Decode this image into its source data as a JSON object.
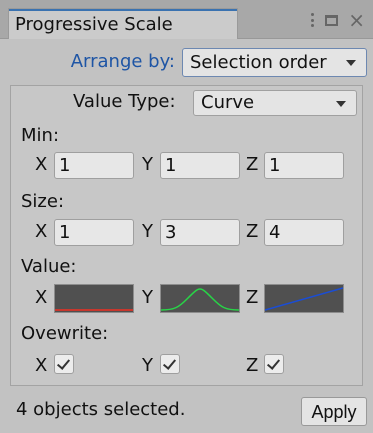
{
  "window": {
    "title": "Progressive Scale"
  },
  "arrange": {
    "label": "Arrange by:",
    "value": "Selection order"
  },
  "value_type": {
    "label": "Value Type:",
    "value": "Curve"
  },
  "axes": {
    "x": "X",
    "y": "Y",
    "z": "Z"
  },
  "min": {
    "label": "Min:",
    "x": "1",
    "y": "1",
    "z": "1"
  },
  "size": {
    "label": "Size:",
    "x": "1",
    "y": "3",
    "z": "4"
  },
  "value": {
    "label": "Value:",
    "curves": {
      "x": {
        "color": "#c8372d",
        "shape": "flat"
      },
      "y": {
        "color": "#28d447",
        "shape": "bell"
      },
      "z": {
        "color": "#1a4dd6",
        "shape": "linear"
      }
    }
  },
  "overwrite": {
    "label": "Ovewrite:",
    "x": true,
    "y": true,
    "z": true
  },
  "footer": {
    "status": "4 objects selected.",
    "apply_label": "Apply"
  },
  "colors": {
    "accent": "#3a72b0",
    "label_blue": "#1e55a5",
    "panel_bg": "#c2c2c2",
    "curve_bg": "#505050"
  },
  "icons": {
    "menu": "kebab-menu-icon",
    "maximize": "maximize-icon",
    "close": "close-icon",
    "dropdown": "chevron-down-icon",
    "check": "check-icon"
  }
}
